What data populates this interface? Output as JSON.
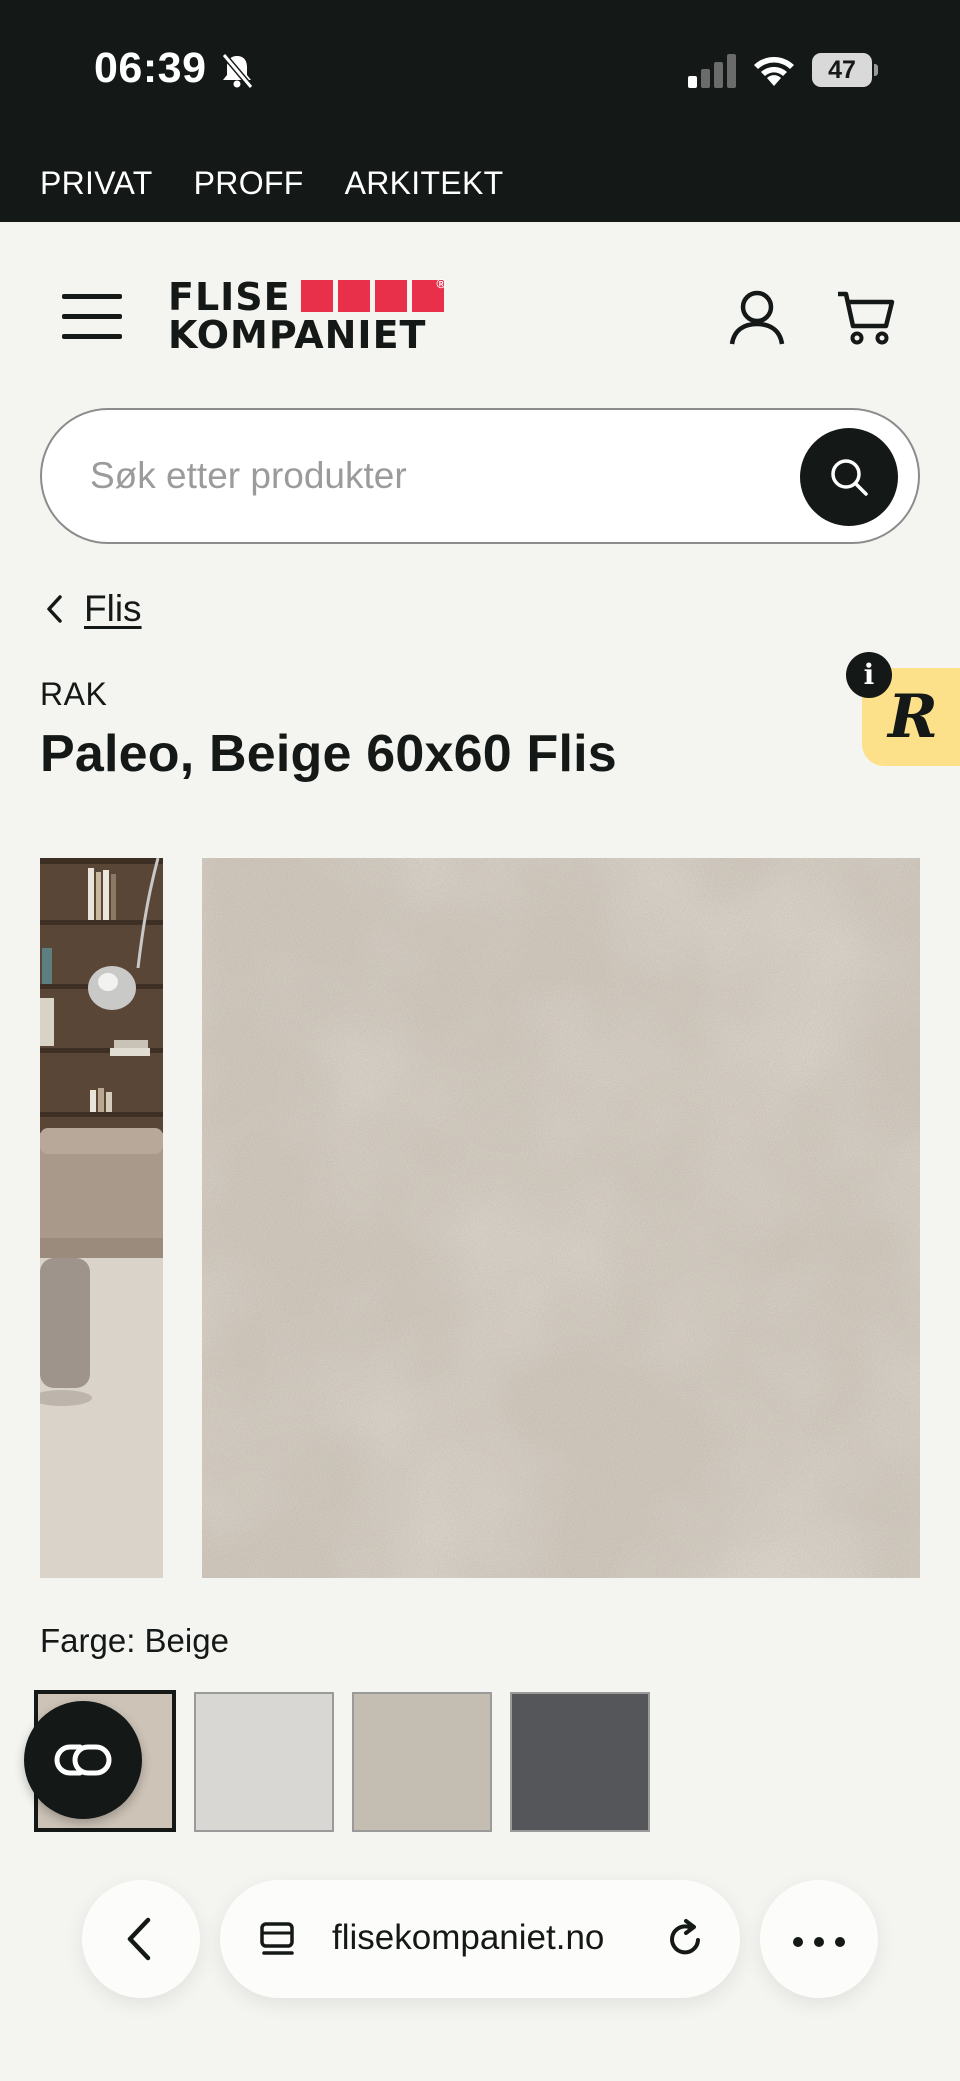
{
  "status_bar": {
    "time": "06:39",
    "battery": "47"
  },
  "segments": [
    {
      "label": "PRIVAT"
    },
    {
      "label": "PROFF"
    },
    {
      "label": "ARKITEKT"
    }
  ],
  "logo": {
    "line1": "FLISE",
    "line2": "KOMPANIET",
    "brand_color": "#e8304a"
  },
  "search": {
    "placeholder": "Søk etter produkter",
    "value": ""
  },
  "breadcrumb": {
    "label": "Flis"
  },
  "product": {
    "brand": "RAK",
    "title": "Paleo, Beige 60x60 Flis",
    "color_label": "Farge: Beige"
  },
  "swatches": [
    {
      "name": "Beige",
      "color": "#cdc3b7",
      "selected": true
    },
    {
      "name": "Light grey",
      "color": "#d9d7d3",
      "selected": false
    },
    {
      "name": "Greige",
      "color": "#c4bdb2",
      "selected": false
    },
    {
      "name": "Anthracite",
      "color": "#55565a",
      "selected": false
    }
  ],
  "widget": {
    "letter": "R",
    "info": "i"
  },
  "browser": {
    "url": "flisekompaniet.no"
  },
  "icons": [
    "bell-slash-icon",
    "signal-icon",
    "wifi-icon",
    "battery-icon",
    "menu-icon",
    "user-icon",
    "cart-icon",
    "search-icon",
    "chevron-left-icon",
    "link-icon",
    "tabs-icon",
    "reload-icon",
    "more-icon"
  ],
  "colors": {
    "dark": "#141816",
    "background": "#f4f4f1",
    "accent": "#e8304a",
    "widget": "#fde08a"
  }
}
